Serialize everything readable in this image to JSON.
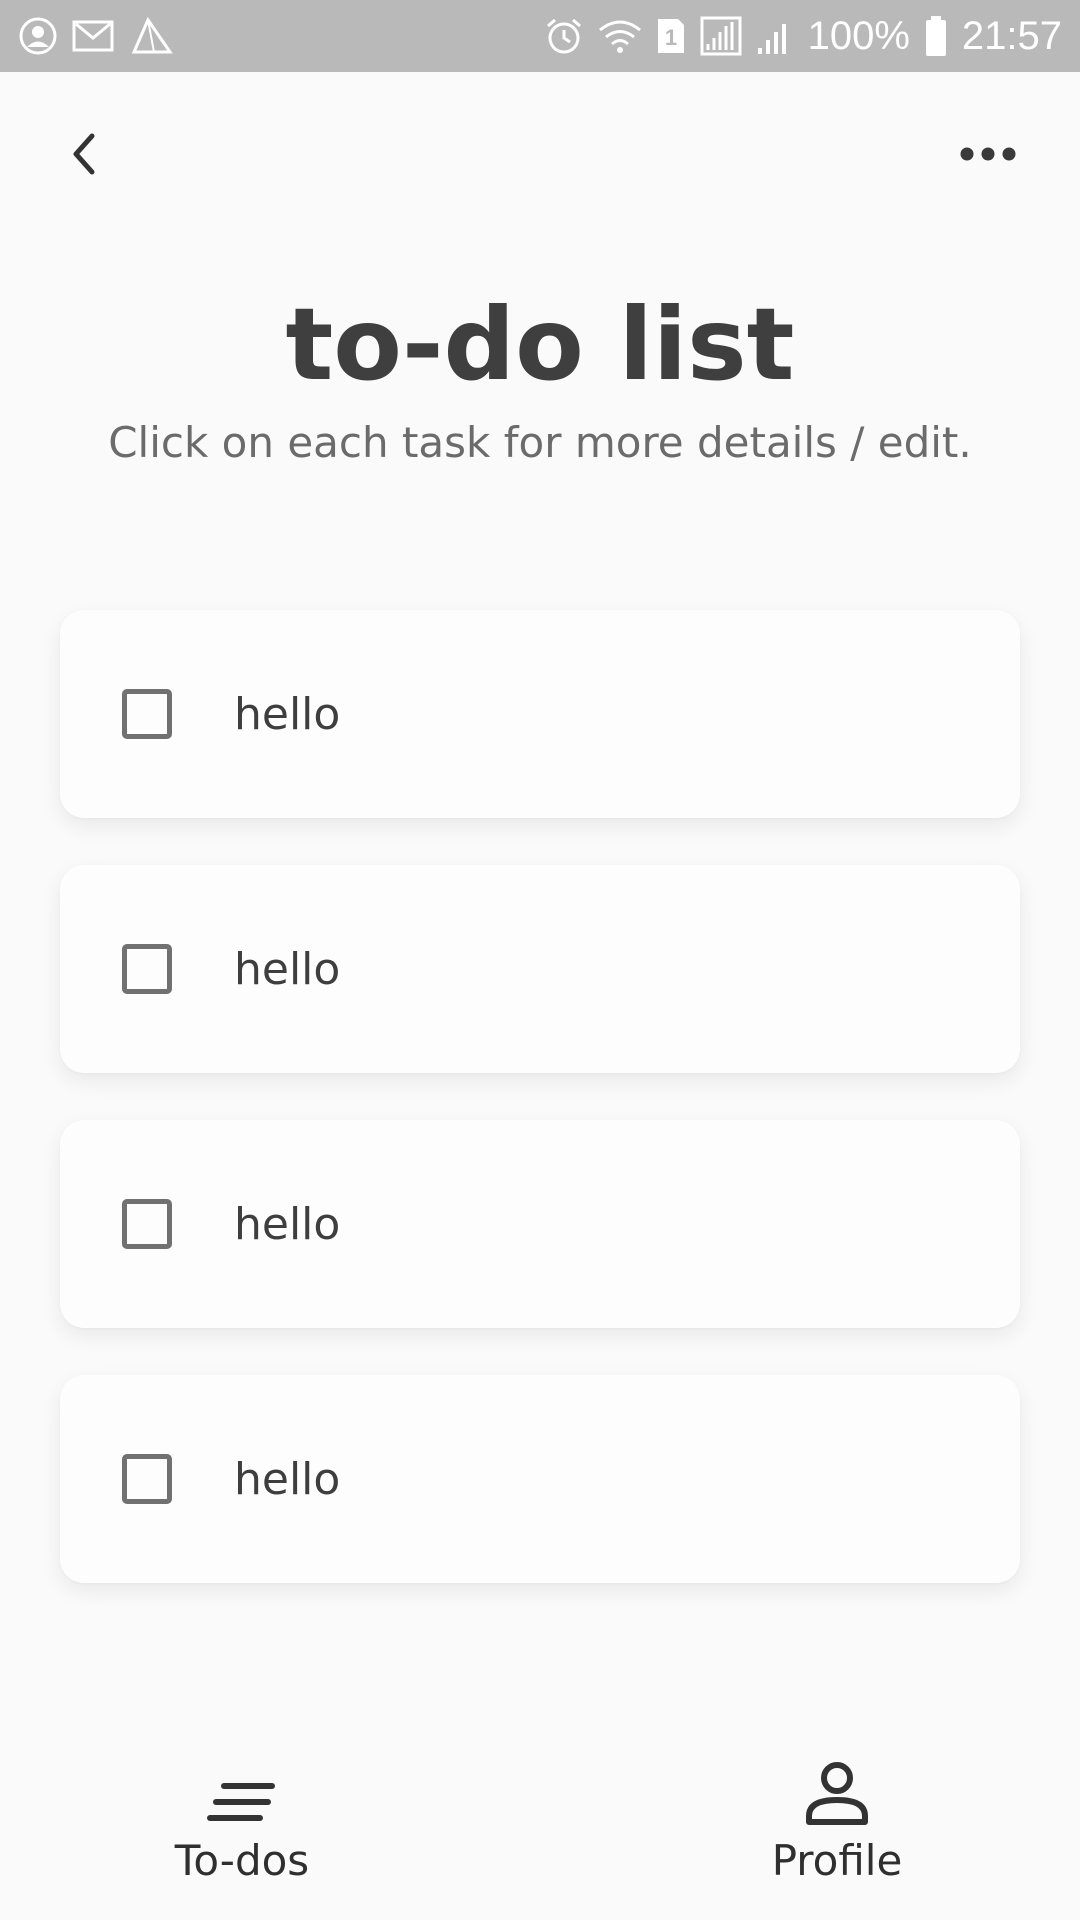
{
  "status_bar": {
    "left_icons": [
      "account-circle-icon",
      "mail-icon",
      "paper-plane-icon"
    ],
    "right_icons": [
      "alarm-icon",
      "wifi-icon",
      "sim-1-icon",
      "signal-icon",
      "signal-weak-icon",
      "battery-icon"
    ],
    "battery": "100%",
    "time": "21:57"
  },
  "top_bar": {
    "back_icon": "chevron-left-icon",
    "more_icon": "more-horizontal-icon"
  },
  "header": {
    "title": "to-do list",
    "subtitle": "Click on each task for more details / edit."
  },
  "tasks": [
    {
      "label": "hello",
      "checked": false
    },
    {
      "label": "hello",
      "checked": false
    },
    {
      "label": "hello",
      "checked": false
    },
    {
      "label": "hello",
      "checked": false
    }
  ],
  "bottom_nav": {
    "items": [
      {
        "label": "To-dos",
        "icon": "list-icon"
      },
      {
        "label": "Profile",
        "icon": "person-icon"
      }
    ]
  },
  "colors": {
    "background": "#fafafa",
    "status_bar": "#b9b9b9",
    "title_highlight": "#dbe3f3",
    "text": "#3e3e3e"
  }
}
